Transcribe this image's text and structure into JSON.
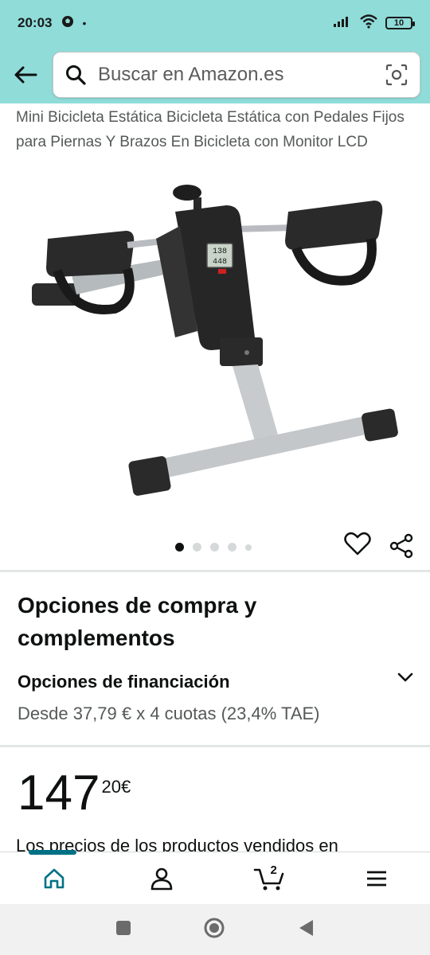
{
  "status_bar": {
    "time": "20:03",
    "dot": "•",
    "battery": "10",
    "left_icons": [
      "soccer-ball-icon"
    ],
    "right_icons": [
      "signal-icon",
      "wifi-icon",
      "battery-icon"
    ]
  },
  "search": {
    "placeholder": "Buscar en Amazon.es",
    "icons": [
      "back-arrow-icon",
      "search-icon",
      "camera-scan-icon"
    ]
  },
  "product": {
    "title": "Mini Bicicleta Estática Bicicleta Estática con Pedales Fijos para Piernas Y Brazos En Bicicleta con Monitor LCD",
    "lcd_top": "138",
    "lcd_bottom": "448",
    "image_count": 5,
    "active_image": 1
  },
  "purchase": {
    "section_title": "Opciones de compra y complementos",
    "financing_title": "Opciones de financiación",
    "financing_detail": "Desde 37,79 € x 4 cuotas (23,4% TAE)"
  },
  "price": {
    "whole": "147",
    "fraction": "20",
    "currency": "€",
    "note": "Los precios de los productos vendidos en"
  },
  "bottom_nav": {
    "items": [
      "home-icon",
      "account-icon",
      "cart-icon",
      "menu-icon"
    ],
    "cart_count": "2",
    "active": "home",
    "accent": "#007185"
  },
  "colors": {
    "header_bg": "#8fdcd9",
    "text_primary": "#0f1111",
    "text_secondary": "#565959"
  }
}
